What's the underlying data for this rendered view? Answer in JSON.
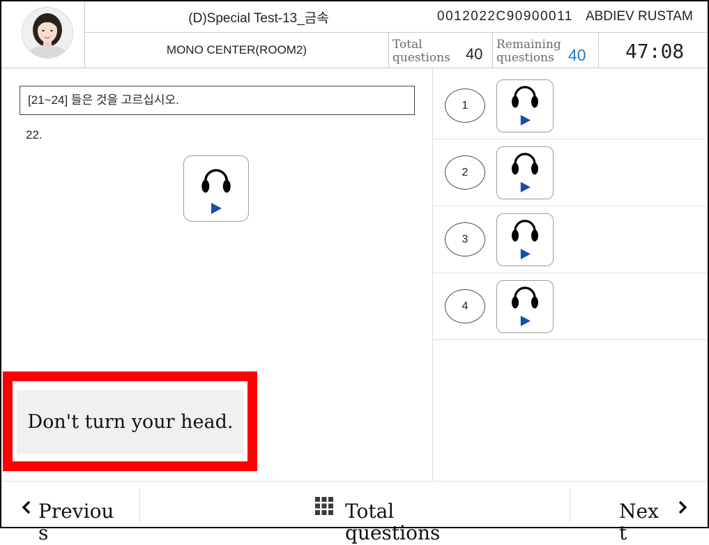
{
  "header": {
    "test_title": "(D)Special Test-13_금속",
    "candidate_id": "0012022C90900011",
    "candidate_name": "ABDIEV RUSTAM",
    "center_name": "MONO CENTER(ROOM2)",
    "total_questions": {
      "label": "Total questions",
      "value": "40"
    },
    "remaining_questions": {
      "label": "Remaining questions",
      "value": "40"
    },
    "timer": "47:08"
  },
  "question": {
    "instruction": "[21~24] 들은 것을 고르십시오.",
    "number": "22."
  },
  "options": [
    {
      "number": "1"
    },
    {
      "number": "2"
    },
    {
      "number": "3"
    },
    {
      "number": "4"
    }
  ],
  "warning": {
    "message": "Don't turn your head."
  },
  "footer": {
    "previous_label": "Previous",
    "total_questions_label": "Total questions",
    "next_label": "Next"
  },
  "icons": {
    "audio": "headphones-icon",
    "play": "play-icon",
    "previous": "chevron-left-icon",
    "next": "chevron-right-icon",
    "question_list": "grid-icon"
  },
  "colors": {
    "frame": "#000000",
    "remaining_count": "#1a7cc4",
    "play_icon": "#1550a8",
    "warning_border": "#ff0000",
    "warning_background": "#f0f0f0"
  }
}
